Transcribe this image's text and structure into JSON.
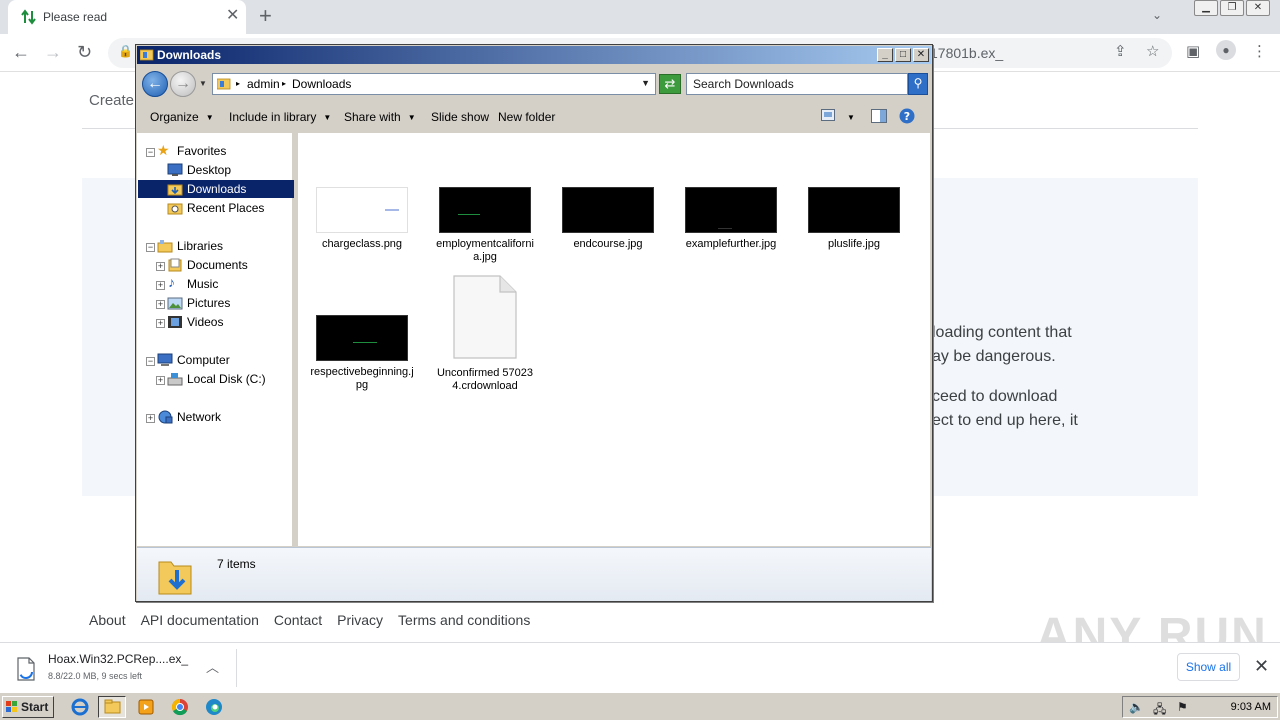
{
  "browser": {
    "tab_title": "Please read",
    "url_fragment": "17801b.ex_",
    "page": {
      "create_text": "Create",
      "lines": [
        "loading content that",
        "ay be dangerous.",
        "ceed to download",
        "ect to end up here, it"
      ],
      "footer_links": [
        "About",
        "API documentation",
        "Contact",
        "Privacy",
        "Terms and conditions"
      ]
    },
    "download": {
      "filename": "Hoax.Win32.PCRep....ex_",
      "status": "8.8/22.0 MB, 9 secs left",
      "show_all": "Show all"
    },
    "watermark": "ANY RUN"
  },
  "explorer": {
    "title": "Downloads",
    "breadcrumb": [
      "admin",
      "Downloads"
    ],
    "search_placeholder": "Search Downloads",
    "commands": [
      "Organize",
      "Include in library",
      "Share with",
      "Slide show",
      "New folder"
    ],
    "nav": {
      "favorites": "Favorites",
      "desktop": "Desktop",
      "downloads": "Downloads",
      "recent": "Recent Places",
      "libraries": "Libraries",
      "documents": "Documents",
      "music": "Music",
      "pictures": "Pictures",
      "videos": "Videos",
      "computer": "Computer",
      "localdisk": "Local Disk (C:)",
      "network": "Network"
    },
    "files": [
      {
        "name": "chargeclass.png"
      },
      {
        "name": "employmentcalifornia.jpg"
      },
      {
        "name": "endcourse.jpg"
      },
      {
        "name": "examplefurther.jpg"
      },
      {
        "name": "pluslife.jpg"
      },
      {
        "name": "respectivebeginning.jpg"
      },
      {
        "name": "Unconfirmed 570234.crdownload"
      }
    ],
    "status": "7 items"
  },
  "taskbar": {
    "start": "Start",
    "clock": "9:03 AM"
  },
  "colors": {
    "titlebar_start": "#0a246a",
    "titlebar_end": "#a6caf0",
    "selection": "#0a246a",
    "link_blue": "#1a73e8"
  }
}
